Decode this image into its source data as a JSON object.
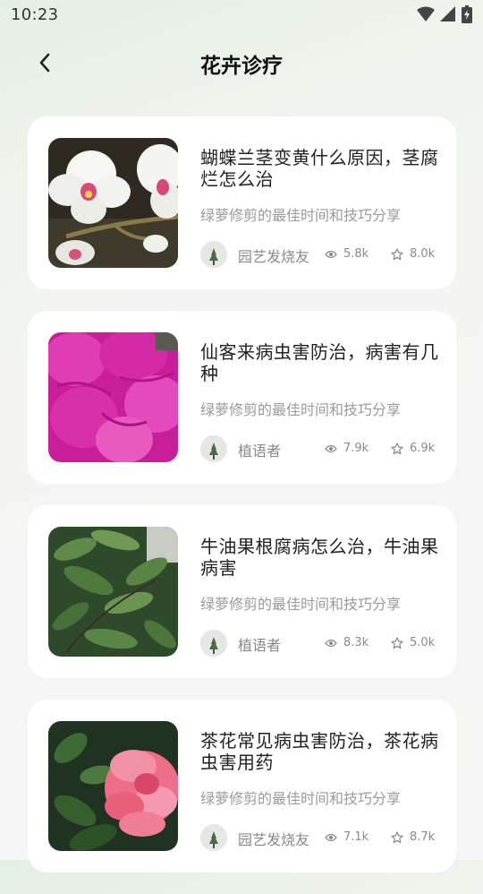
{
  "status_bar": {
    "time": "10:23"
  },
  "header": {
    "title": "花卉诊疗"
  },
  "articles": [
    {
      "title": "蝴蝶兰茎变黄什么原因，茎腐烂怎么治",
      "subtitle": "绿萝修剪的最佳时间和技巧分享",
      "author": "园艺发烧友",
      "views": "5.8k",
      "stars": "8.0k",
      "image": "white-orchid"
    },
    {
      "title": "仙客来病虫害防治，病害有几种",
      "subtitle": "绿萝修剪的最佳时间和技巧分享",
      "author": "植语者",
      "views": "7.9k",
      "stars": "6.9k",
      "image": "magenta-cyclamen"
    },
    {
      "title": "牛油果根腐病怎么治，牛油果病害",
      "subtitle": "绿萝修剪的最佳时间和技巧分享",
      "author": "植语者",
      "views": "8.3k",
      "stars": "5.0k",
      "image": "avocado-leaves"
    },
    {
      "title": "茶花常见病虫害防治，茶花病虫害用药",
      "subtitle": "绿萝修剪的最佳时间和技巧分享",
      "author": "园艺发烧友",
      "views": "7.1k",
      "stars": "8.7k",
      "image": "pink-camellia"
    }
  ]
}
